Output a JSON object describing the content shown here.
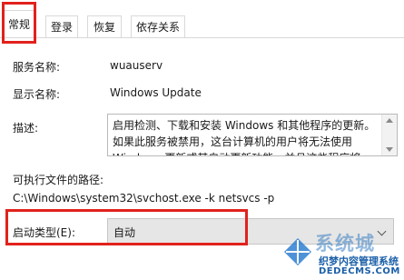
{
  "tabs": [
    {
      "label": "常规",
      "active": true
    },
    {
      "label": "登录",
      "active": false
    },
    {
      "label": "恢复",
      "active": false
    },
    {
      "label": "依存关系",
      "active": false
    }
  ],
  "service": {
    "name_label": "服务名称:",
    "name_value": "wuauserv",
    "display_label": "显示名称:",
    "display_value": "Windows Update",
    "description_label": "描述:",
    "description_text": "启用检测、下载和安装 Windows 和其他程序的更新。如果此服务被禁用，这台计算机的用户将无法使用 Windows 更新或其自动更新功能，并且这些程序将",
    "path_label": "可执行文件的路径:",
    "path_value": "C:\\Windows\\system32\\svchost.exe -k netsvcs -p",
    "startup_label": "启动类型(E):",
    "startup_value": "自动"
  },
  "watermark": {
    "line1": "系统城",
    "line2": "织梦内容管理系统",
    "line3": "DEDECMS.COM"
  },
  "colors": {
    "highlight": "#e2211c",
    "select_bg": "#e6e6e6",
    "watermark_blue": "#1a5fa8"
  }
}
